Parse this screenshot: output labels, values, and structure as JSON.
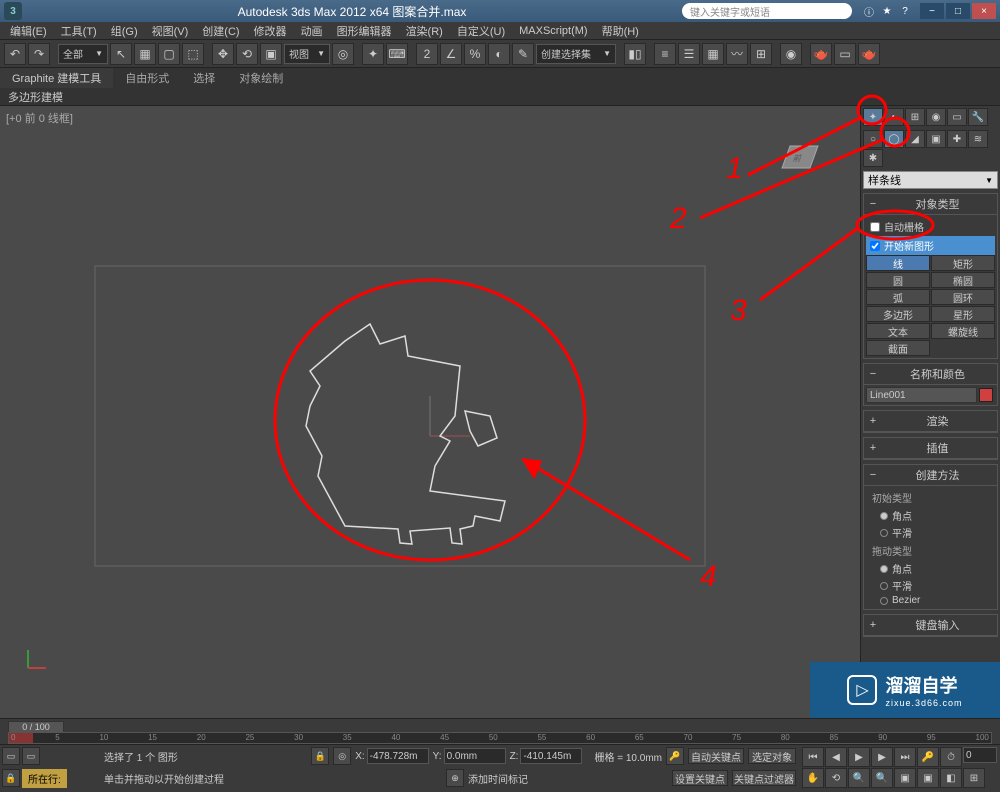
{
  "titlebar": {
    "app_icon": "3",
    "title": "Autodesk 3ds Max  2012 x64    图案合并.max",
    "search_placeholder": "键入关键字或短语"
  },
  "menu": {
    "edit": "编辑(E)",
    "tools": "工具(T)",
    "group": "组(G)",
    "views": "视图(V)",
    "create": "创建(C)",
    "modifiers": "修改器",
    "animation": "动画",
    "graph_editors": "图形编辑器",
    "rendering": "渲染(R)",
    "customize": "自定义(U)",
    "maxscript": "MAXScript(M)",
    "help": "帮助(H)"
  },
  "toolbar": {
    "all_combo": "全部",
    "view_btn": "视图",
    "selection_set": "创建选择集"
  },
  "ribbon": {
    "tab_graphite": "Graphite 建模工具",
    "tab_freeform": "自由形式",
    "tab_selection": "选择",
    "tab_paint": "对象绘制",
    "sub_poly": "多边形建模"
  },
  "viewport": {
    "label": "[+0 前 0 线框]"
  },
  "command_panel": {
    "spline_combo": "样条线",
    "obj_type_header": "对象类型",
    "auto_grid": "自动栅格",
    "start_new": "开始新图形",
    "btn_line": "线",
    "btn_rect": "矩形",
    "btn_circle": "圆",
    "btn_ellipse": "椭圆",
    "btn_arc": "弧",
    "btn_donut": "圆环",
    "btn_ngon": "多边形",
    "btn_star": "星形",
    "btn_text": "文本",
    "btn_helix": "螺旋线",
    "btn_section": "截面",
    "name_color_header": "名称和颜色",
    "name_value": "Line001",
    "render_header": "渲染",
    "interp_header": "插值",
    "creation_header": "创建方法",
    "initial_type": "初始类型",
    "drag_type": "拖动类型",
    "corner": "角点",
    "smooth": "平滑",
    "bezier": "Bezier",
    "keyboard_header": "键盘输入"
  },
  "timeline": {
    "slider": "0 / 100",
    "ticks": [
      "0",
      "5",
      "10",
      "15",
      "20",
      "25",
      "30",
      "35",
      "40",
      "45",
      "50",
      "55",
      "60",
      "65",
      "70",
      "75",
      "80",
      "85",
      "90",
      "95",
      "100"
    ]
  },
  "status": {
    "location": "所在行:",
    "sel_info": "选择了 1 个 图形",
    "prompt": "单击并拖动以开始创建过程",
    "add_key": "添加时间标记",
    "x_label": "X:",
    "x_val": "-478.728m",
    "y_label": "Y:",
    "y_val": "0.0mm",
    "z_label": "Z:",
    "z_val": "-410.145m",
    "grid_label": "栅格 = 10.0mm",
    "auto_key": "自动关键点",
    "set_key": "设置关键点",
    "sel_obj": "选定对象",
    "key_filter": "关键点过滤器"
  },
  "annotations": {
    "n1": "1",
    "n2": "2",
    "n3": "3",
    "n4": "4"
  },
  "watermark": {
    "main": "溜溜自学",
    "sub": "zixue.3d66.com"
  }
}
